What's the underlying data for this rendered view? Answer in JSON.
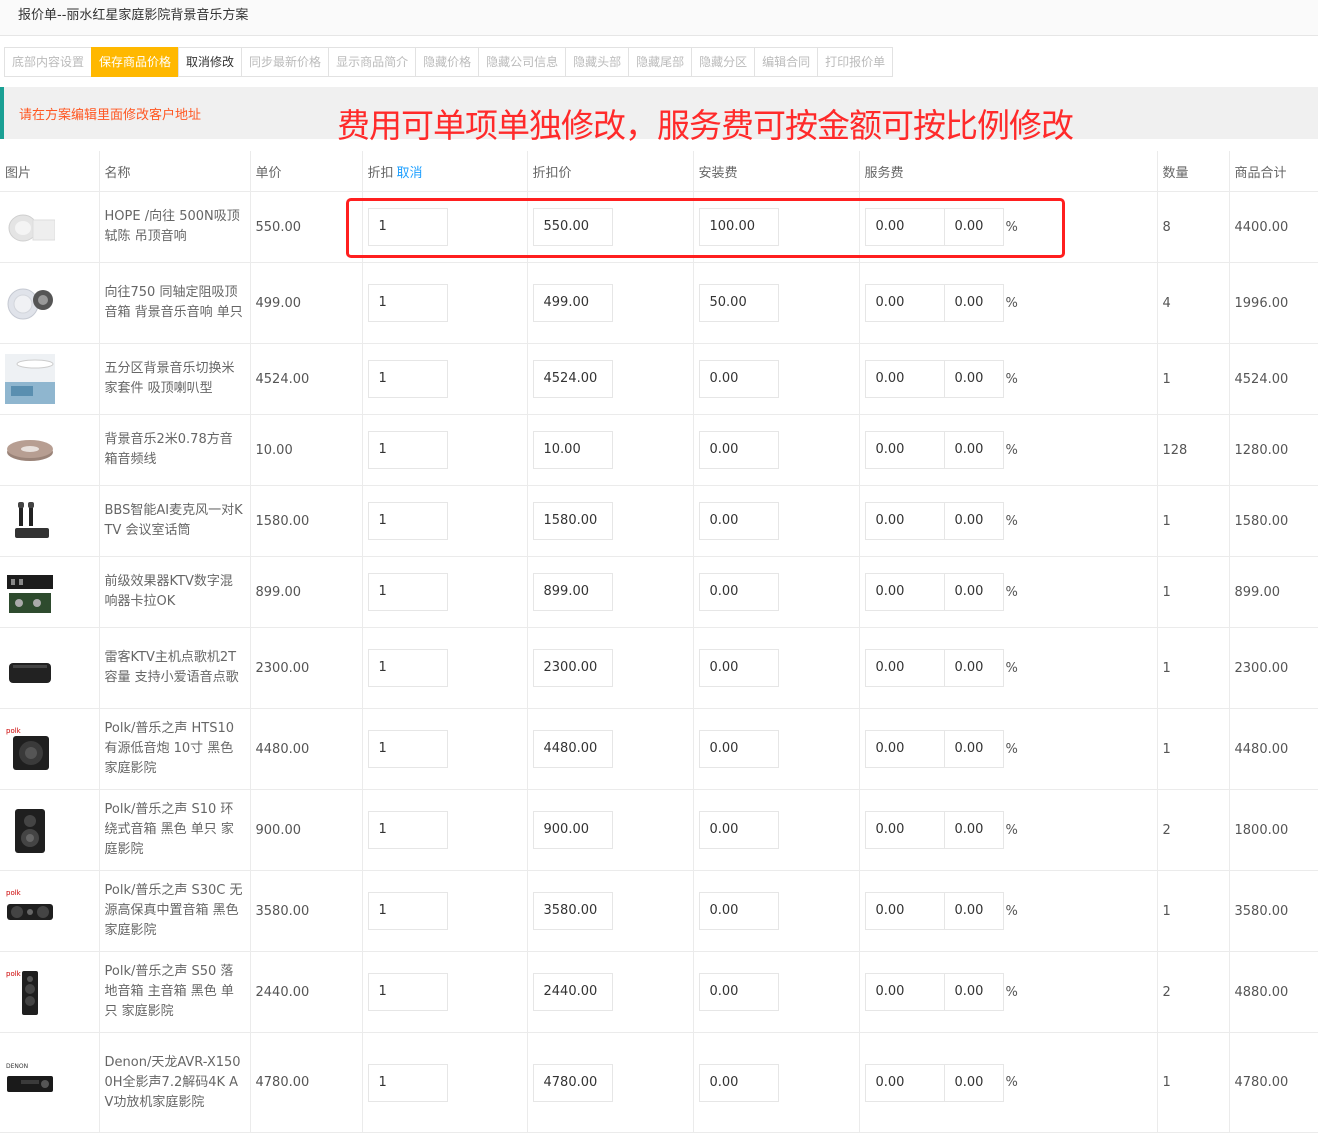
{
  "header": {
    "title": "报价单--丽水红星家庭影院背景音乐方案"
  },
  "toolbar": [
    {
      "label": "底部内容设置",
      "style": "muted"
    },
    {
      "label": "保存商品价格",
      "style": "primary"
    },
    {
      "label": "取消修改",
      "style": "dark"
    },
    {
      "label": "同步最新价格",
      "style": "muted"
    },
    {
      "label": "显示商品简介",
      "style": "muted"
    },
    {
      "label": "隐藏价格",
      "style": "muted"
    },
    {
      "label": "隐藏公司信息",
      "style": "muted"
    },
    {
      "label": "隐藏头部",
      "style": "muted"
    },
    {
      "label": "隐藏尾部",
      "style": "muted"
    },
    {
      "label": "隐藏分区",
      "style": "muted"
    },
    {
      "label": "编辑合同",
      "style": "muted"
    },
    {
      "label": "打印报价单",
      "style": "muted"
    }
  ],
  "notice": "请在方案编辑里面修改客户地址",
  "annotation": "费用可单项单独修改，服务费可按金额可按比例修改",
  "table": {
    "headers": {
      "image": "图片",
      "name": "名称",
      "price": "单价",
      "discount": "折扣",
      "cancel": "取消",
      "discount_price": "折扣价",
      "install_fee": "安装费",
      "service_fee": "服务费",
      "quantity": "数量",
      "subtotal": "商品合计"
    },
    "percent_sign": "%",
    "rows": [
      {
        "img": "ceiling-speaker-white-icon",
        "name": "HOPE /向往 500N吸顶轼陈 吊顶音响",
        "price": "550.00",
        "discount": "1",
        "discount_price": "550.00",
        "install_fee": "100.00",
        "service_amount": "0.00",
        "service_pct": "0.00",
        "qty": "8",
        "total": "4400.00"
      },
      {
        "img": "ceiling-speaker-round-icon",
        "name": "向往750 同轴定阻吸顶音箱 背景音乐音响 单只",
        "price": "499.00",
        "discount": "1",
        "discount_price": "499.00",
        "install_fee": "50.00",
        "service_amount": "0.00",
        "service_pct": "0.00",
        "qty": "4",
        "total": "1996.00"
      },
      {
        "img": "room-kit-photo-icon",
        "name": "五分区背景音乐切换米家套件 吸顶喇叭型",
        "price": "4524.00",
        "discount": "1",
        "discount_price": "4524.00",
        "install_fee": "0.00",
        "service_amount": "0.00",
        "service_pct": "0.00",
        "qty": "1",
        "total": "4524.00"
      },
      {
        "img": "cable-reel-icon",
        "name": "背景音乐2米0.78方音箱音频线",
        "price": "10.00",
        "discount": "1",
        "discount_price": "10.00",
        "install_fee": "0.00",
        "service_amount": "0.00",
        "service_pct": "0.00",
        "qty": "128",
        "total": "1280.00"
      },
      {
        "img": "microphone-pair-icon",
        "name": "BBS智能AI麦克风一对KTV 会议室话筒",
        "price": "1580.00",
        "discount": "1",
        "discount_price": "1580.00",
        "install_fee": "0.00",
        "service_amount": "0.00",
        "service_pct": "0.00",
        "qty": "1",
        "total": "1580.00"
      },
      {
        "img": "mixer-box-icon",
        "name": "前级效果器KTV数字混响器卡拉OK",
        "price": "899.00",
        "discount": "1",
        "discount_price": "899.00",
        "install_fee": "0.00",
        "service_amount": "0.00",
        "service_pct": "0.00",
        "qty": "1",
        "total": "899.00"
      },
      {
        "img": "ktv-host-box-icon",
        "name": "雷客KTV主机点歌机2T容量 支持小爱语音点歌",
        "price": "2300.00",
        "discount": "1",
        "discount_price": "2300.00",
        "install_fee": "0.00",
        "service_amount": "0.00",
        "service_pct": "0.00",
        "qty": "1",
        "total": "2300.00"
      },
      {
        "img": "subwoofer-icon",
        "name": "Polk/普乐之声 HTS10有源低音炮 10寸 黑色 家庭影院",
        "price": "4480.00",
        "discount": "1",
        "discount_price": "4480.00",
        "install_fee": "0.00",
        "service_amount": "0.00",
        "service_pct": "0.00",
        "qty": "1",
        "total": "4480.00"
      },
      {
        "img": "surround-speaker-icon",
        "name": "Polk/普乐之声 S10 环绕式音箱 黑色 单只 家庭影院",
        "price": "900.00",
        "discount": "1",
        "discount_price": "900.00",
        "install_fee": "0.00",
        "service_amount": "0.00",
        "service_pct": "0.00",
        "qty": "2",
        "total": "1800.00"
      },
      {
        "img": "center-speaker-icon",
        "name": "Polk/普乐之声 S30C 无源高保真中置音箱 黑色 家庭影院",
        "price": "3580.00",
        "discount": "1",
        "discount_price": "3580.00",
        "install_fee": "0.00",
        "service_amount": "0.00",
        "service_pct": "0.00",
        "qty": "1",
        "total": "3580.00"
      },
      {
        "img": "floor-speaker-icon",
        "name": "Polk/普乐之声 S50 落地音箱 主音箱 黑色 单只 家庭影院",
        "price": "2440.00",
        "discount": "1",
        "discount_price": "2440.00",
        "install_fee": "0.00",
        "service_amount": "0.00",
        "service_pct": "0.00",
        "qty": "2",
        "total": "4880.00"
      },
      {
        "img": "av-receiver-icon",
        "name": "Denon/天龙AVR-X1500H全影声7.2解码4K AV功放机家庭影院",
        "price": "4780.00",
        "discount": "1",
        "discount_price": "4780.00",
        "install_fee": "0.00",
        "service_amount": "0.00",
        "service_pct": "0.00",
        "qty": "1",
        "total": "4780.00"
      }
    ]
  },
  "brand_marks": {
    "polk": "polk",
    "denon": "DENON"
  }
}
